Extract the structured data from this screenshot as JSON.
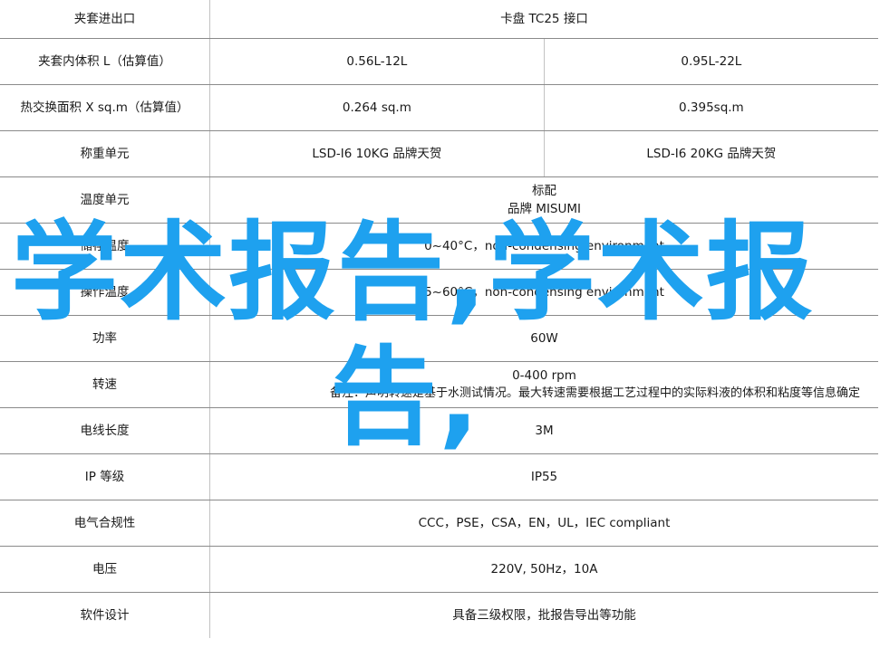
{
  "rows": [
    {
      "label": "夹套进出口",
      "span": "卡盘 TC25 接口"
    },
    {
      "label": "夹套内体积 L（估算值）",
      "v1": "0.56L-12L",
      "v2": "0.95L-22L"
    },
    {
      "label": "热交换面积 X sq.m（估算值）",
      "v1": "0.264 sq.m",
      "v2": "0.395sq.m"
    },
    {
      "label": "称重单元",
      "v1": "LSD-I6 10KG 品牌天贺",
      "v2": "LSD-I6 20KG 品牌天贺"
    },
    {
      "label": "温度单元",
      "span_line1": "标配",
      "span_line2": "品牌 MISUMI"
    },
    {
      "label": "储存温度",
      "span": "0~40°C，non-condensing environment"
    },
    {
      "label": "操作温度",
      "span": "5~60°C，non-condensing environment"
    },
    {
      "label": "功率",
      "span": "60W"
    },
    {
      "label": "转速",
      "span_line1": "0-400 rpm",
      "span_note": "备注：声明转速是基于水测试情况。最大转速需要根据工艺过程中的实际料液的体积和粘度等信息确定"
    },
    {
      "label": "电线长度",
      "span": "3M"
    },
    {
      "label": "IP 等级",
      "span": "IP55"
    },
    {
      "label": "电气合规性",
      "span": "CCC，PSE，CSA，EN，UL，IEC compliant"
    },
    {
      "label": "电压",
      "span": "220V, 50Hz，10A"
    },
    {
      "label": "软件设计",
      "span": "具备三级权限，批报告导出等功能"
    }
  ],
  "watermark": {
    "line1": "学术报告,学术报",
    "line2": "告,",
    "color": "#1ea1ef"
  }
}
